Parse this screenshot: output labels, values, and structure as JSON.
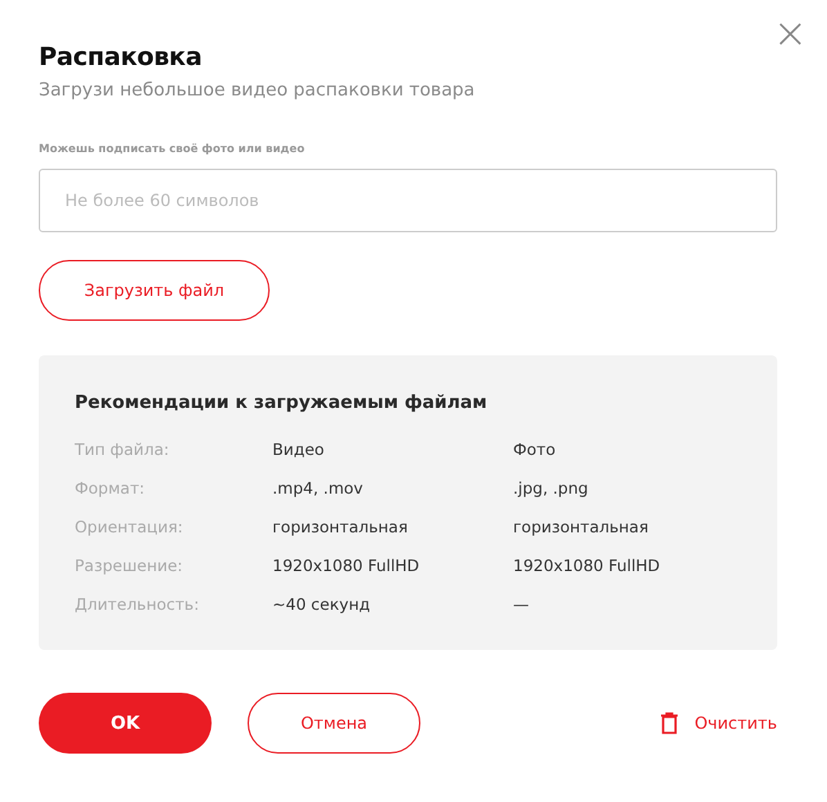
{
  "dialog": {
    "title": "Распаковка",
    "subtitle": "Загрузи небольшое видео распаковки товара",
    "close": "×"
  },
  "caption_field": {
    "label": "Можешь подписать своё фото или видео",
    "placeholder": "Не более 60 символов"
  },
  "upload_button": "Загрузить файл",
  "recommendations": {
    "title": "Рекомендации к загружаемым файлам",
    "rows": [
      {
        "label": "Тип файла:",
        "values": [
          "Видео",
          "Фото"
        ]
      },
      {
        "label": "Формат:",
        "values": [
          ".mp4, .mov",
          ".jpg, .png"
        ]
      },
      {
        "label": "Ориентация:",
        "values": [
          "горизонтальная",
          "горизонтальная"
        ]
      },
      {
        "label": "Разрешение:",
        "values": [
          "1920x1080 FullHD",
          "1920x1080 FullHD"
        ]
      },
      {
        "label": "Длительность:",
        "values": [
          "~40 секунд",
          "—"
        ]
      }
    ]
  },
  "footer": {
    "ok": "OK",
    "cancel": "Отмена",
    "clear": "Очистить"
  }
}
